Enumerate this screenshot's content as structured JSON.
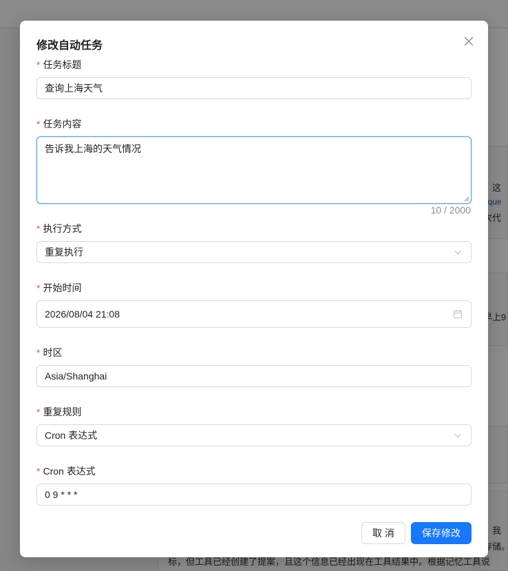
{
  "background": {
    "snippets": [
      "，这",
      "eque",
      "次代",
      "早上9",
      "，我",
      "存储。"
    ],
    "bottom_line": "标，但工具已经创建了提案，且这个信息已经出现在工具结果中。根据记忆工具说"
  },
  "modal": {
    "title": "修改自动任务",
    "close_icon": "close-icon",
    "required_mark": "*",
    "fields": {
      "task_title": {
        "label": "任务标题",
        "value": "查询上海天气"
      },
      "task_content": {
        "label": "任务内容",
        "value": "告诉我上海的天气情况",
        "count": "10 / 2000"
      },
      "exec_mode": {
        "label": "执行方式",
        "value": "重复执行"
      },
      "start_time": {
        "label": "开始时间",
        "value": "2026/08/04 21:08"
      },
      "timezone": {
        "label": "时区",
        "value": "Asia/Shanghai"
      },
      "repeat_rule": {
        "label": "重复规则",
        "value": "Cron 表达式"
      },
      "cron": {
        "label": "Cron 表达式",
        "value": "0 9 * * *"
      }
    },
    "buttons": {
      "cancel": "取 消",
      "save": "保存修改"
    }
  },
  "colors": {
    "primary": "#1677ff",
    "required": "#ff4d4f",
    "focus_border": "#4096ff"
  }
}
